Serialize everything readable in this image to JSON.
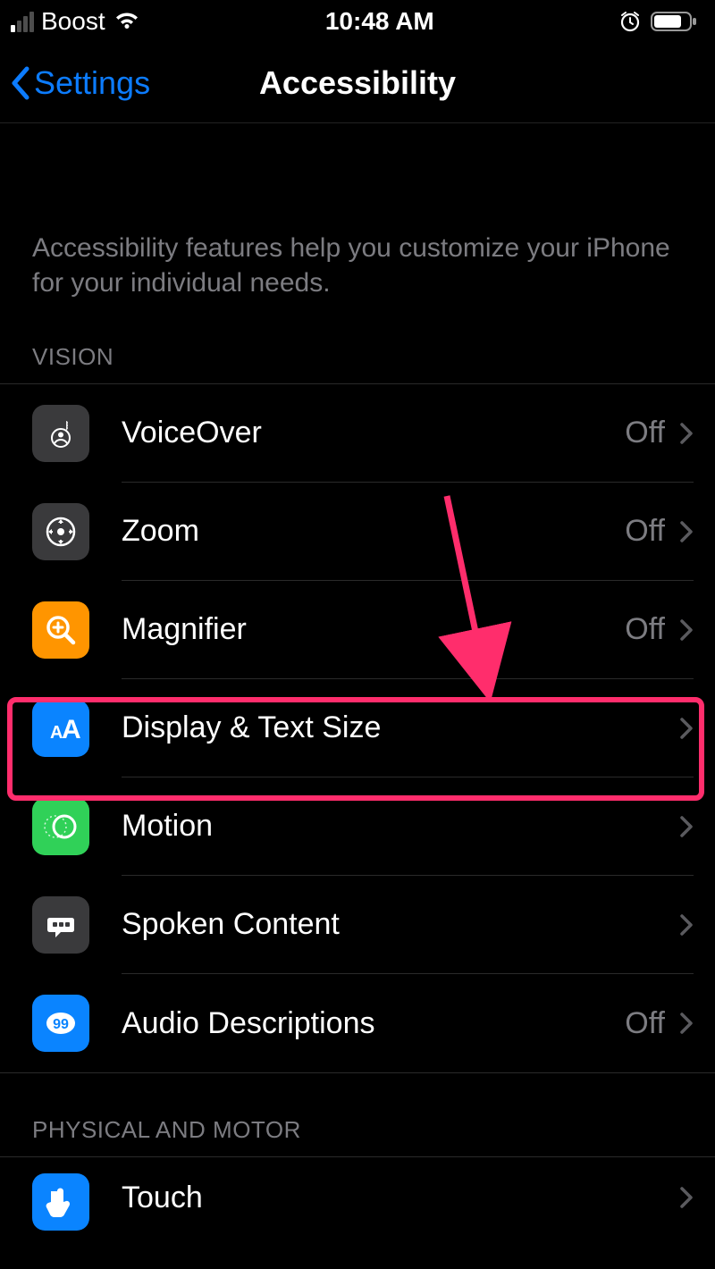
{
  "status": {
    "carrier": "Boost",
    "time": "10:48 AM"
  },
  "nav": {
    "back": "Settings",
    "title": "Accessibility"
  },
  "intro": "Accessibility features help you customize your iPhone for your individual needs.",
  "sections": {
    "vision_header": "VISION",
    "physical_header": "PHYSICAL AND MOTOR"
  },
  "rows": {
    "voiceover": {
      "label": "VoiceOver",
      "value": "Off"
    },
    "zoom": {
      "label": "Zoom",
      "value": "Off"
    },
    "magnifier": {
      "label": "Magnifier",
      "value": "Off"
    },
    "display_text": {
      "label": "Display & Text Size",
      "value": ""
    },
    "motion": {
      "label": "Motion",
      "value": ""
    },
    "spoken_content": {
      "label": "Spoken Content",
      "value": ""
    },
    "audio_desc": {
      "label": "Audio Descriptions",
      "value": "Off"
    },
    "touch": {
      "label": "Touch",
      "value": ""
    }
  },
  "annotation": {
    "highlighted_row": "display_text"
  }
}
